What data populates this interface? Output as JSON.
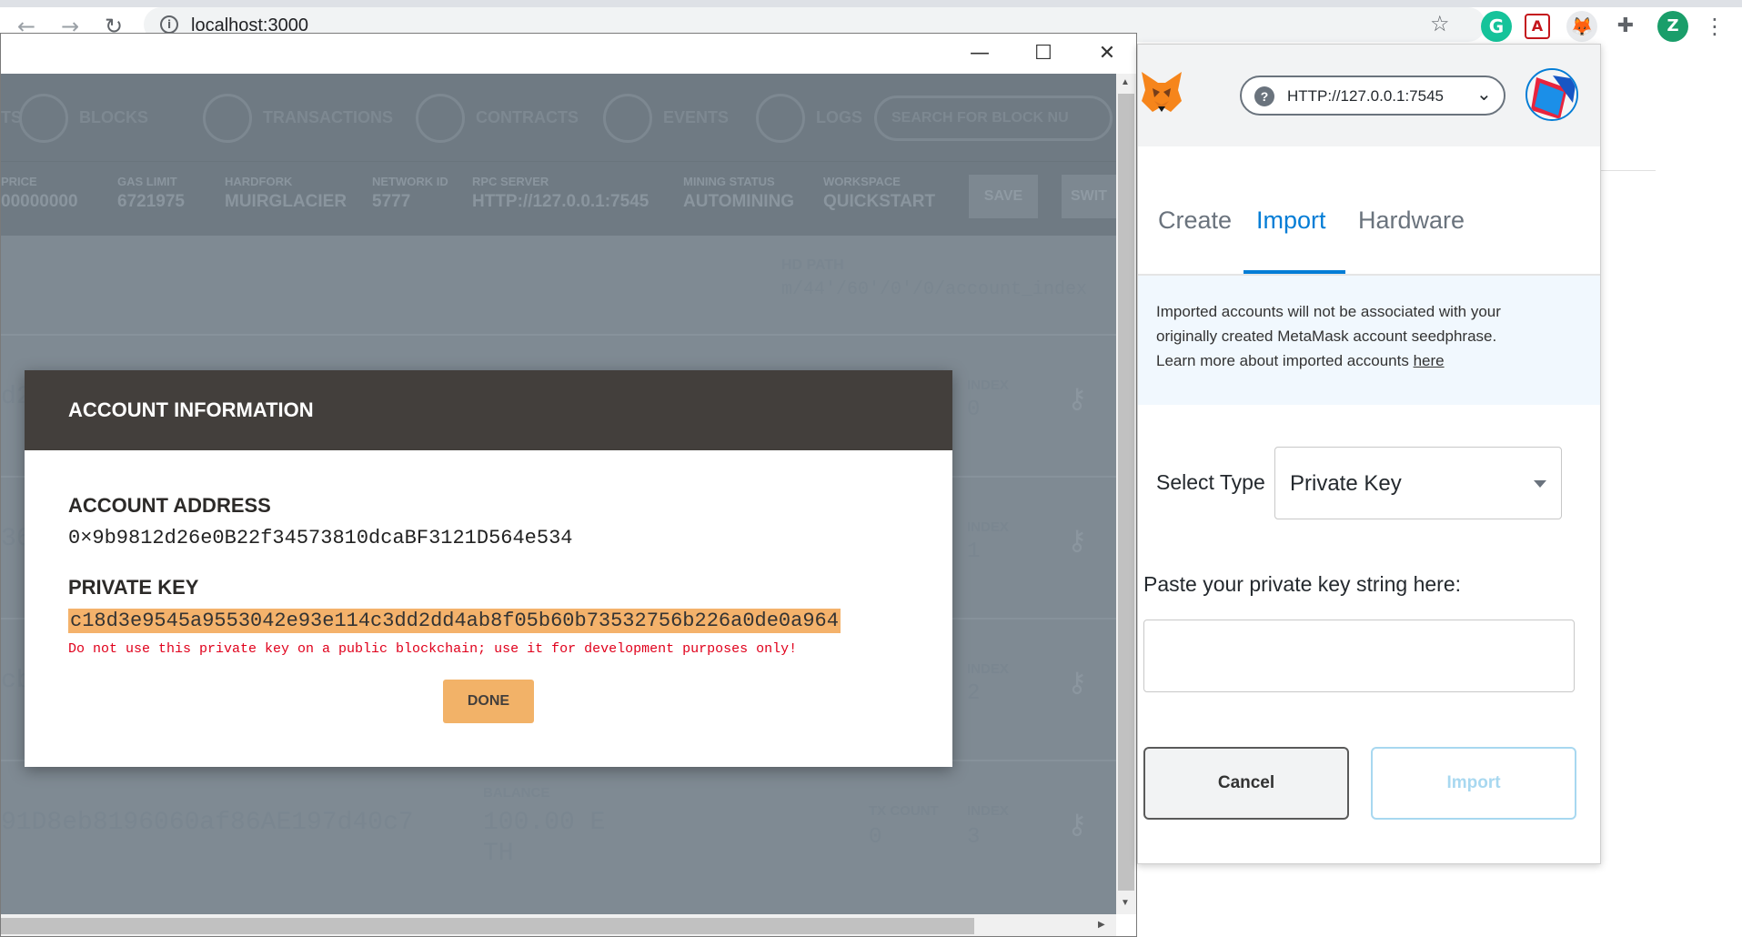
{
  "browser": {
    "url": "localhost:3000",
    "nav": {
      "back": "←",
      "forward": "→",
      "reload": "↻"
    },
    "extensions": [
      {
        "name": "grammarly-icon",
        "glyph": "G",
        "color": "#15c39a"
      },
      {
        "name": "acrobat-icon",
        "glyph": "A",
        "color": "#c4161c"
      },
      {
        "name": "metamask-icon",
        "glyph": "🦊",
        "color": "#f6851b"
      },
      {
        "name": "extensions-puzzle-icon",
        "glyph": "✚",
        "color": "#5f6368"
      }
    ],
    "profile_initial": "Z",
    "menu_glyph": "⋮"
  },
  "window": {
    "controls": {
      "minimize": "—",
      "maximize": "☐",
      "close": "✕"
    }
  },
  "ganache": {
    "nav": [
      {
        "label": "TS"
      },
      {
        "label": "BLOCKS"
      },
      {
        "label": "TRANSACTIONS"
      },
      {
        "label": "CONTRACTS"
      },
      {
        "label": "EVENTS"
      },
      {
        "label": "LOGS"
      }
    ],
    "search_placeholder": "SEARCH FOR BLOCK NU",
    "stats": [
      {
        "key": "PRICE",
        "value": "00000000"
      },
      {
        "key": "GAS LIMIT",
        "value": "6721975"
      },
      {
        "key": "HARDFORK",
        "value": "MUIRGLACIER"
      },
      {
        "key": "NETWORK ID",
        "value": "5777"
      },
      {
        "key": "RPC SERVER",
        "value": "HTTP://127.0.0.1:7545"
      },
      {
        "key": "MINING STATUS",
        "value": "AUTOMINING"
      },
      {
        "key": "WORKSPACE",
        "value": "QUICKSTART"
      }
    ],
    "buttons": {
      "save": "SAVE",
      "switch": "SWIT"
    },
    "hd_path_label": "HD PATH",
    "hd_path_value": "m/44'/60'/0'/0/account_index",
    "accounts": [
      {
        "addr_frag": "d2",
        "index_label": "INDEX",
        "index": "0"
      },
      {
        "addr_frag": "36",
        "index_label": "INDEX",
        "index": "1"
      },
      {
        "addr_frag": "cb",
        "balance_frag": "TH",
        "tx_frag": "5",
        "index_label": "INDEX",
        "index": "2"
      },
      {
        "addr_frag": "91D8eb8196060af86AE197d40c7",
        "balance_label": "BALANCE",
        "balance": "100.00 E",
        "balance_tail": "TH",
        "tx_label": "TX COUNT",
        "tx": "0",
        "index_label": "INDEX",
        "index": "3"
      }
    ]
  },
  "modal": {
    "title": "ACCOUNT INFORMATION",
    "address_label": "ACCOUNT ADDRESS",
    "address": "0×9b9812d26e0B22f34573810dcaBF3121D564e534",
    "key_label": "PRIVATE KEY",
    "private_key": "c18d3e9545a9553042e93e114c3dd2dd4ab8f05b60b73532756b226a0de0a964",
    "warning": "Do not use this private key on a public blockchain; use it for development purposes only!",
    "done": "DONE"
  },
  "metamask": {
    "network": "HTTP://127.0.0.1:7545",
    "tabs": [
      {
        "label": "Create"
      },
      {
        "label": "Import"
      },
      {
        "label": "Hardware"
      }
    ],
    "info_line1": "Imported accounts will not be associated with your",
    "info_line2": "originally created MetaMask account seedphrase.",
    "info_line3": "Learn more about imported accounts",
    "info_link": "here",
    "select_label": "Select Type",
    "select_value": "Private Key",
    "paste_label": "Paste your private key string here:",
    "cancel": "Cancel",
    "import": "Import"
  }
}
